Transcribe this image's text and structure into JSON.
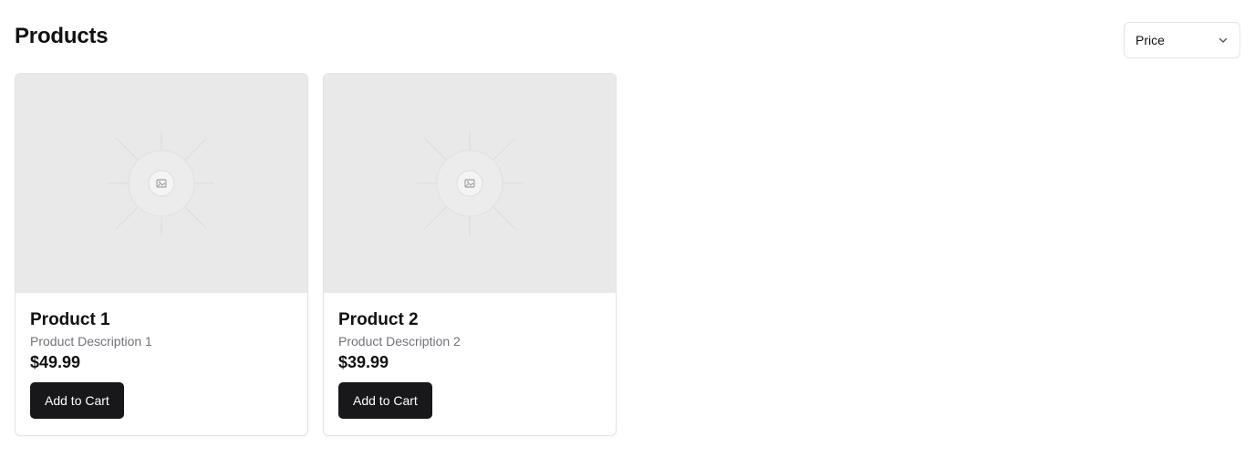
{
  "page": {
    "title": "Products"
  },
  "sort": {
    "selected": "Price",
    "icon": "chevron-down-icon"
  },
  "products": [
    {
      "name": "Product 1",
      "description": "Product Description 1",
      "price": "$49.99",
      "button_label": "Add to Cart",
      "image_icon": "image-placeholder-icon"
    },
    {
      "name": "Product 2",
      "description": "Product Description 2",
      "price": "$39.99",
      "button_label": "Add to Cart",
      "image_icon": "image-placeholder-icon"
    }
  ],
  "colors": {
    "button_bg": "#18181b",
    "image_bg": "#e9e9e9",
    "muted_text": "#71717a",
    "border": "#e4e4e7"
  }
}
